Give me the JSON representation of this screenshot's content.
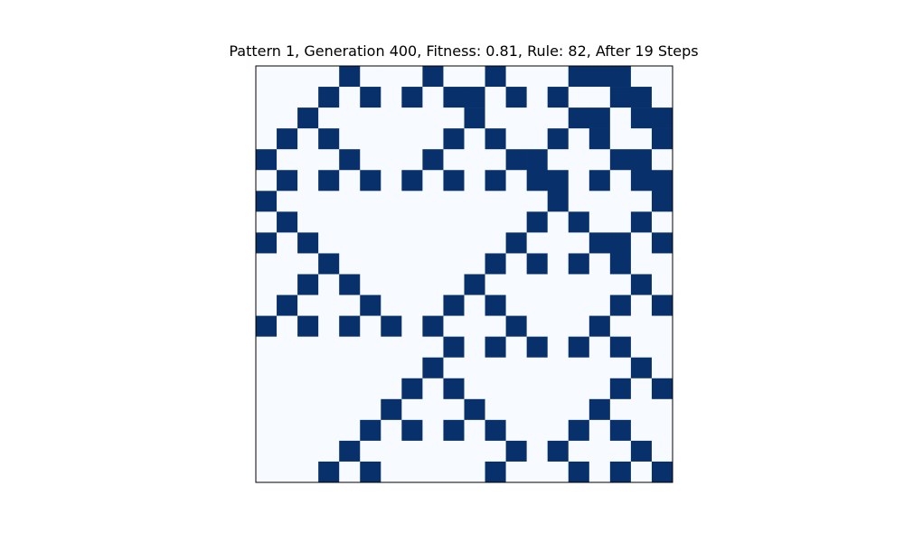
{
  "chart_data": {
    "type": "heatmap",
    "title": "Pattern 1, Generation 400, Fitness: 0.81, Rule: 82, After 19 Steps",
    "colormap": "Blues",
    "colors": {
      "on": "#08306b",
      "off": "#f7fbff",
      "frame": "#000000"
    },
    "rows": 20,
    "cols": 20,
    "grid": [
      [
        0,
        0,
        0,
        0,
        1,
        0,
        0,
        0,
        1,
        0,
        0,
        1,
        0,
        0,
        0,
        1,
        1,
        1,
        0,
        0
      ],
      [
        0,
        0,
        0,
        1,
        0,
        1,
        0,
        1,
        0,
        1,
        1,
        0,
        1,
        0,
        1,
        0,
        0,
        1,
        1,
        0
      ],
      [
        0,
        0,
        1,
        0,
        0,
        0,
        0,
        0,
        0,
        0,
        1,
        0,
        0,
        0,
        0,
        1,
        1,
        0,
        1,
        1
      ],
      [
        0,
        1,
        0,
        1,
        0,
        0,
        0,
        0,
        0,
        1,
        0,
        1,
        0,
        0,
        1,
        0,
        1,
        0,
        0,
        1
      ],
      [
        1,
        0,
        0,
        0,
        1,
        0,
        0,
        0,
        1,
        0,
        0,
        0,
        1,
        1,
        0,
        0,
        0,
        1,
        1,
        0
      ],
      [
        0,
        1,
        0,
        1,
        0,
        1,
        0,
        1,
        0,
        1,
        0,
        1,
        0,
        1,
        1,
        0,
        1,
        0,
        1,
        1
      ],
      [
        1,
        0,
        0,
        0,
        0,
        0,
        0,
        0,
        0,
        0,
        0,
        0,
        0,
        0,
        1,
        0,
        0,
        0,
        0,
        1
      ],
      [
        0,
        1,
        0,
        0,
        0,
        0,
        0,
        0,
        0,
        0,
        0,
        0,
        0,
        1,
        0,
        1,
        0,
        0,
        1,
        0
      ],
      [
        1,
        0,
        1,
        0,
        0,
        0,
        0,
        0,
        0,
        0,
        0,
        0,
        1,
        0,
        0,
        0,
        1,
        1,
        0,
        1
      ],
      [
        0,
        0,
        0,
        1,
        0,
        0,
        0,
        0,
        0,
        0,
        0,
        1,
        0,
        1,
        0,
        1,
        0,
        1,
        0,
        0
      ],
      [
        0,
        0,
        1,
        0,
        1,
        0,
        0,
        0,
        0,
        0,
        1,
        0,
        0,
        0,
        0,
        0,
        0,
        0,
        1,
        0
      ],
      [
        0,
        1,
        0,
        0,
        0,
        1,
        0,
        0,
        0,
        1,
        0,
        1,
        0,
        0,
        0,
        0,
        0,
        1,
        0,
        1
      ],
      [
        1,
        0,
        1,
        0,
        1,
        0,
        1,
        0,
        1,
        0,
        0,
        0,
        1,
        0,
        0,
        0,
        1,
        0,
        0,
        0
      ],
      [
        0,
        0,
        0,
        0,
        0,
        0,
        0,
        0,
        0,
        1,
        0,
        1,
        0,
        1,
        0,
        1,
        0,
        1,
        0,
        0
      ],
      [
        0,
        0,
        0,
        0,
        0,
        0,
        0,
        0,
        1,
        0,
        0,
        0,
        0,
        0,
        0,
        0,
        0,
        0,
        1,
        0
      ],
      [
        0,
        0,
        0,
        0,
        0,
        0,
        0,
        1,
        0,
        1,
        0,
        0,
        0,
        0,
        0,
        0,
        0,
        1,
        0,
        1
      ],
      [
        0,
        0,
        0,
        0,
        0,
        0,
        1,
        0,
        0,
        0,
        1,
        0,
        0,
        0,
        0,
        0,
        1,
        0,
        0,
        0
      ],
      [
        0,
        0,
        0,
        0,
        0,
        1,
        0,
        1,
        0,
        1,
        0,
        1,
        0,
        0,
        0,
        1,
        0,
        1,
        0,
        0
      ],
      [
        0,
        0,
        0,
        0,
        1,
        0,
        0,
        0,
        0,
        0,
        0,
        0,
        1,
        0,
        1,
        0,
        0,
        0,
        1,
        0
      ],
      [
        0,
        0,
        0,
        1,
        0,
        1,
        0,
        0,
        0,
        0,
        0,
        1,
        0,
        0,
        0,
        1,
        0,
        1,
        0,
        1
      ]
    ]
  }
}
